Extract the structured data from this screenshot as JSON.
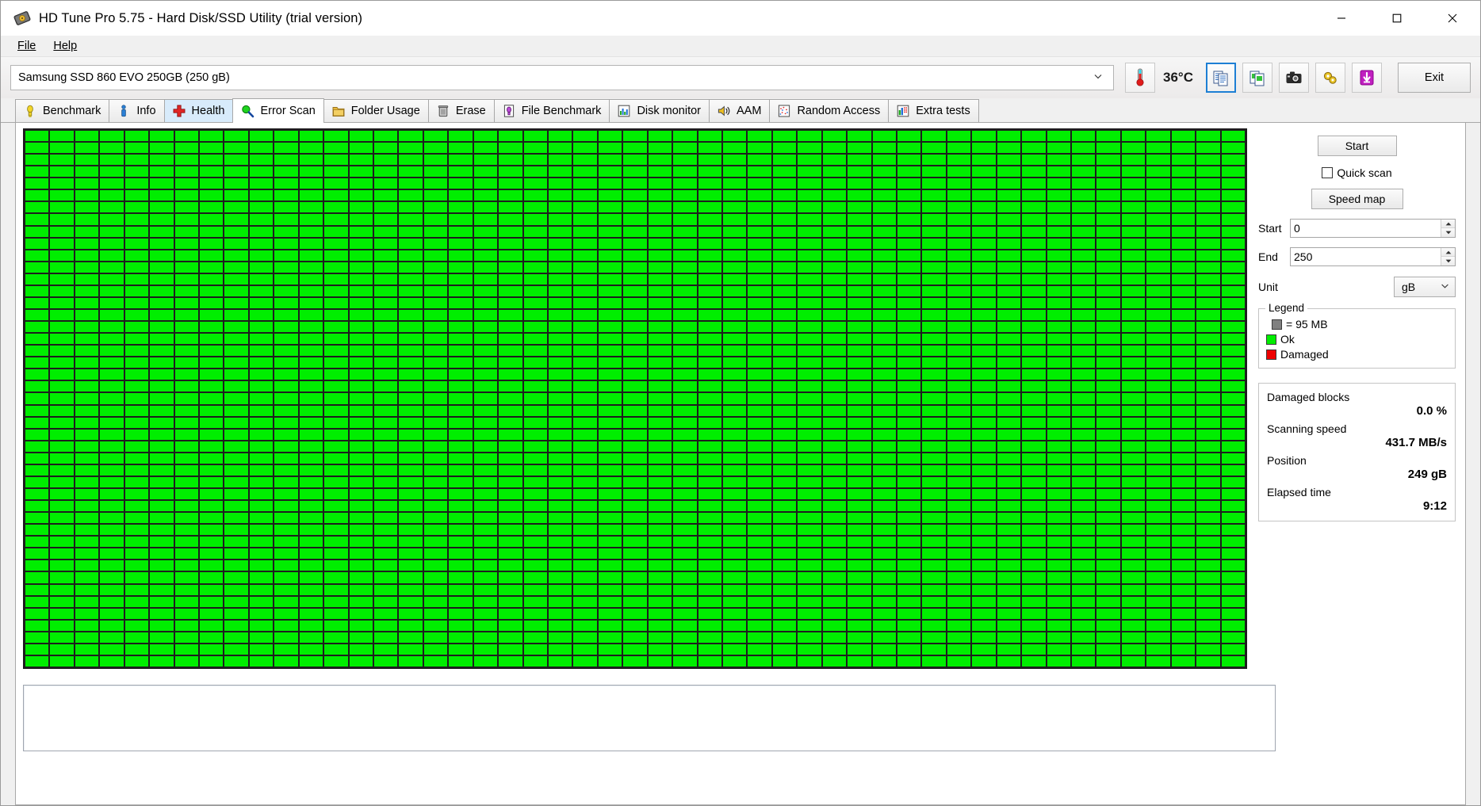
{
  "window": {
    "title": "HD Tune Pro 5.75 - Hard Disk/SSD Utility (trial version)",
    "app_icon": "hard-disk-icon",
    "controls": {
      "minimize": "minimize-icon",
      "maximize": "maximize-icon",
      "close": "close-icon"
    }
  },
  "menu": {
    "items": [
      {
        "label": "File",
        "accel": "F"
      },
      {
        "label": "Help",
        "accel": "H"
      }
    ]
  },
  "toolbar": {
    "drive": {
      "value": "Samsung SSD 860 EVO 250GB (250 gB)",
      "icon": "chevron-down-icon"
    },
    "temperature": {
      "icon": "thermometer-icon",
      "value": "36°C"
    },
    "buttons": [
      {
        "name": "copy-text-button",
        "icon": "copy-documents-icon",
        "active": true
      },
      {
        "name": "copy-image-button",
        "icon": "copy-images-icon",
        "active": false
      },
      {
        "name": "screenshot-button",
        "icon": "camera-icon",
        "active": false
      },
      {
        "name": "options-button",
        "icon": "gears-icon",
        "active": false
      },
      {
        "name": "download-button",
        "icon": "download-arrow-icon",
        "active": false
      }
    ],
    "exit_label": "Exit"
  },
  "tabs": [
    {
      "label": "Benchmark",
      "icon": "lightbulb-icon",
      "state": "normal"
    },
    {
      "label": "Info",
      "icon": "info-person-icon",
      "state": "normal"
    },
    {
      "label": "Health",
      "icon": "red-cross-icon",
      "state": "hot"
    },
    {
      "label": "Error Scan",
      "icon": "magnifier-icon",
      "state": "active"
    },
    {
      "label": "Folder Usage",
      "icon": "folder-icon",
      "state": "normal"
    },
    {
      "label": "Erase",
      "icon": "trash-icon",
      "state": "normal"
    },
    {
      "label": "File Benchmark",
      "icon": "file-bulb-icon",
      "state": "normal"
    },
    {
      "label": "Disk monitor",
      "icon": "bar-chart-icon",
      "state": "normal"
    },
    {
      "label": "AAM",
      "icon": "speaker-icon",
      "state": "normal"
    },
    {
      "label": "Random Access",
      "icon": "scatter-icon",
      "state": "normal"
    },
    {
      "label": "Extra tests",
      "icon": "grid-chart-icon",
      "state": "normal"
    }
  ],
  "scan": {
    "start_button": "Start",
    "quick_scan": {
      "label": "Quick scan",
      "checked": false
    },
    "speed_map_button": "Speed map",
    "range": {
      "start_label": "Start",
      "start_value": "0",
      "end_label": "End",
      "end_value": "250",
      "unit_label": "Unit",
      "unit_value": "gB"
    },
    "legend": {
      "title": "Legend",
      "block_size": "= 95 MB",
      "ok": "Ok",
      "damaged": "Damaged"
    },
    "stats": [
      {
        "label": "Damaged blocks",
        "value": "0.0 %"
      },
      {
        "label": "Scanning speed",
        "value": "431.7 MB/s"
      },
      {
        "label": "Position",
        "value": "249 gB"
      },
      {
        "label": "Elapsed time",
        "value": "9:12"
      }
    ],
    "log_text": ""
  },
  "blockmap": {
    "columns": 49,
    "rows": 45,
    "ok_color": "#00ee00",
    "damaged_color": "#ee0000",
    "grid_color": "#1e1e1e",
    "damaged_indices": [],
    "total_blocks": 2205
  }
}
